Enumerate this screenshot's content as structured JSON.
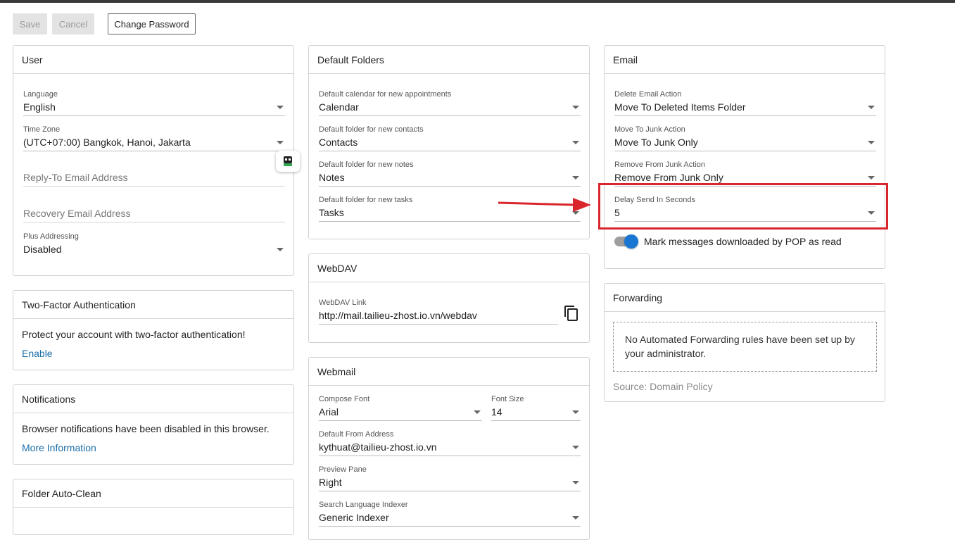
{
  "toolbar": {
    "save_label": "Save",
    "cancel_label": "Cancel",
    "change_password_label": "Change Password"
  },
  "user": {
    "title": "User",
    "language": {
      "label": "Language",
      "value": "English"
    },
    "timezone": {
      "label": "Time Zone",
      "value": "(UTC+07:00) Bangkok, Hanoi, Jakarta"
    },
    "reply_to": {
      "placeholder": "Reply-To Email Address"
    },
    "recovery": {
      "placeholder": "Recovery Email Address"
    },
    "plus": {
      "label": "Plus Addressing",
      "value": "Disabled"
    }
  },
  "two_factor": {
    "title": "Two-Factor Authentication",
    "text": "Protect your account with two-factor authentication!",
    "link": "Enable"
  },
  "notifications": {
    "title": "Notifications",
    "text": "Browser notifications have been disabled in this browser.",
    "link": "More Information"
  },
  "auto_clean": {
    "title": "Folder Auto-Clean"
  },
  "default_folders": {
    "title": "Default Folders",
    "calendar": {
      "label": "Default calendar for new appointments",
      "value": "Calendar"
    },
    "contacts": {
      "label": "Default folder for new contacts",
      "value": "Contacts"
    },
    "notes": {
      "label": "Default folder for new notes",
      "value": "Notes"
    },
    "tasks": {
      "label": "Default folder for new tasks",
      "value": "Tasks"
    }
  },
  "webdav": {
    "title": "WebDAV",
    "label": "WebDAV Link",
    "value": "http://mail.tailieu-zhost.io.vn/webdav"
  },
  "webmail": {
    "title": "Webmail",
    "font": {
      "label": "Compose Font",
      "value": "Arial"
    },
    "size": {
      "label": "Font Size",
      "value": "14"
    },
    "from": {
      "label": "Default From Address",
      "value": "kythuat@tailieu-zhost.io.vn"
    },
    "preview": {
      "label": "Preview Pane",
      "value": "Right"
    },
    "indexer": {
      "label": "Search Language Indexer",
      "value": "Generic Indexer"
    }
  },
  "email": {
    "title": "Email",
    "delete_action": {
      "label": "Delete Email Action",
      "value": "Move To Deleted Items Folder"
    },
    "junk_action": {
      "label": "Move To Junk Action",
      "value": "Move To Junk Only"
    },
    "remove_junk": {
      "label": "Remove From Junk Action",
      "value": "Remove From Junk Only"
    },
    "delay_send": {
      "label": "Delay Send In Seconds",
      "value": "5"
    },
    "pop_toggle_label": "Mark messages downloaded by POP as read",
    "pop_toggle_on": true
  },
  "forwarding": {
    "title": "Forwarding",
    "message": "No Automated Forwarding rules have been set up by your administrator.",
    "source": "Source: Domain Policy"
  },
  "colors": {
    "accent": "#1976d2",
    "link": "#1a6ea8",
    "highlight": "#d9262c"
  }
}
